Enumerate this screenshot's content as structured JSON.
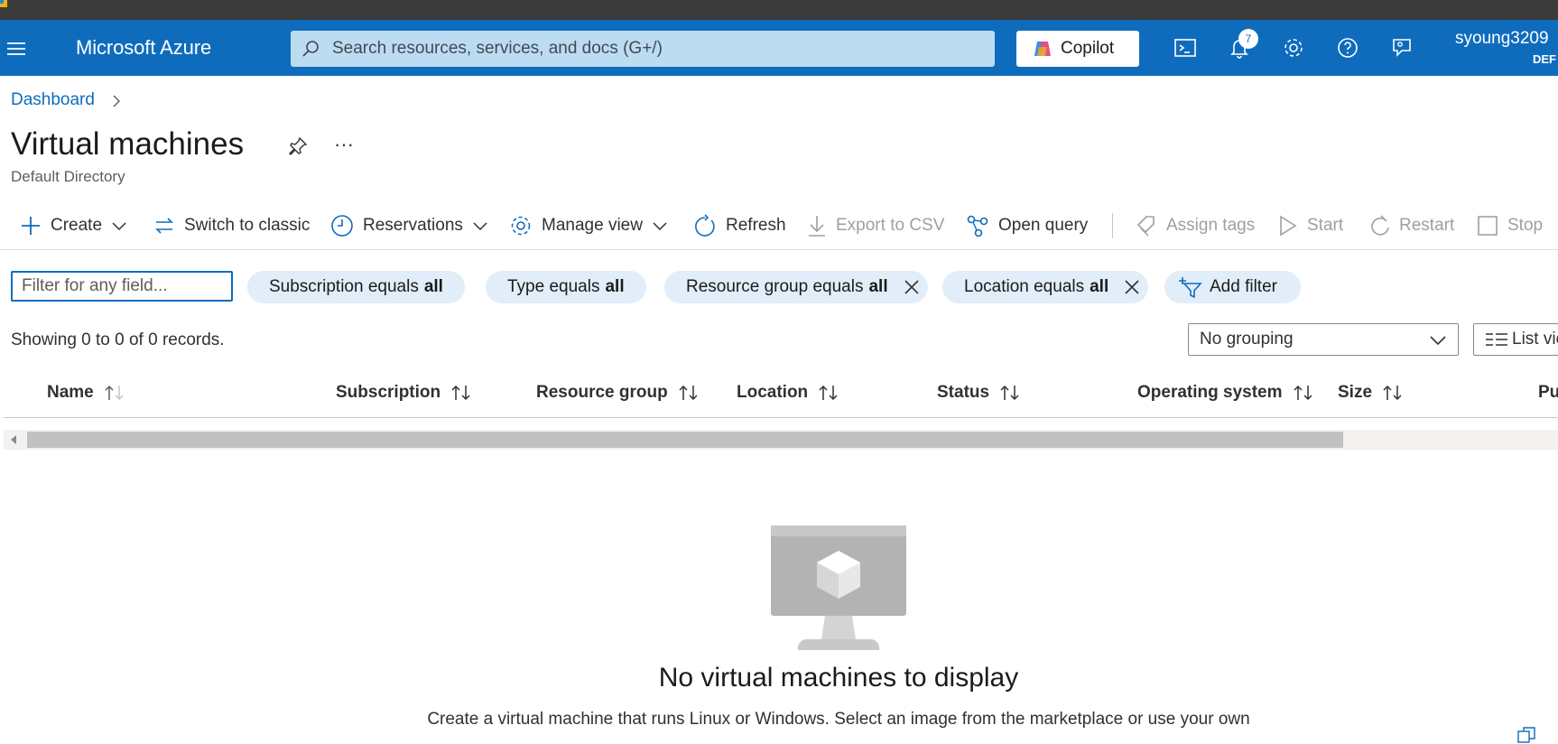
{
  "topbar": {
    "brand": "Microsoft Azure",
    "search_placeholder": "Search resources, services, and docs (G+/)",
    "copilot_label": "Copilot",
    "notification_count": "7",
    "username": "syoung3209",
    "tenant": "DEF",
    "icons": [
      "menu-icon",
      "cloud-shell-icon",
      "bell-icon",
      "gear-icon",
      "help-icon",
      "feedback-icon"
    ]
  },
  "breadcrumb": {
    "items": [
      "Dashboard"
    ]
  },
  "header": {
    "title": "Virtual machines",
    "subtitle": "Default Directory",
    "more": "···"
  },
  "toolbar": {
    "create": "Create",
    "switch_classic": "Switch to classic",
    "reservations": "Reservations",
    "manage_view": "Manage view",
    "refresh": "Refresh",
    "export_csv": "Export to CSV",
    "open_query": "Open query",
    "assign_tags": "Assign tags",
    "start": "Start",
    "restart": "Restart",
    "stop": "Stop"
  },
  "filters": {
    "search_placeholder": "Filter for any field...",
    "pills": [
      {
        "label": "Subscription equals",
        "value": "all"
      },
      {
        "label": "Type equals",
        "value": "all"
      },
      {
        "label": "Resource group equals",
        "value": "all"
      },
      {
        "label": "Location equals",
        "value": "all"
      }
    ],
    "add_filter": "Add filter"
  },
  "records": {
    "summary": "Showing 0 to 0 of 0 records.",
    "grouping": "No grouping",
    "view": "List view"
  },
  "table": {
    "columns": [
      "Name",
      "Subscription",
      "Resource group",
      "Location",
      "Status",
      "Operating system",
      "Size",
      "Pu"
    ]
  },
  "empty_state": {
    "title": "No virtual machines to display",
    "description": "Create a virtual machine that runs Linux or Windows. Select an image from the marketplace or use your own"
  },
  "colors": {
    "azure_blue": "#0f6cbd",
    "search_bg": "#bcdcf2",
    "pill_bg": "#e1eefa"
  }
}
